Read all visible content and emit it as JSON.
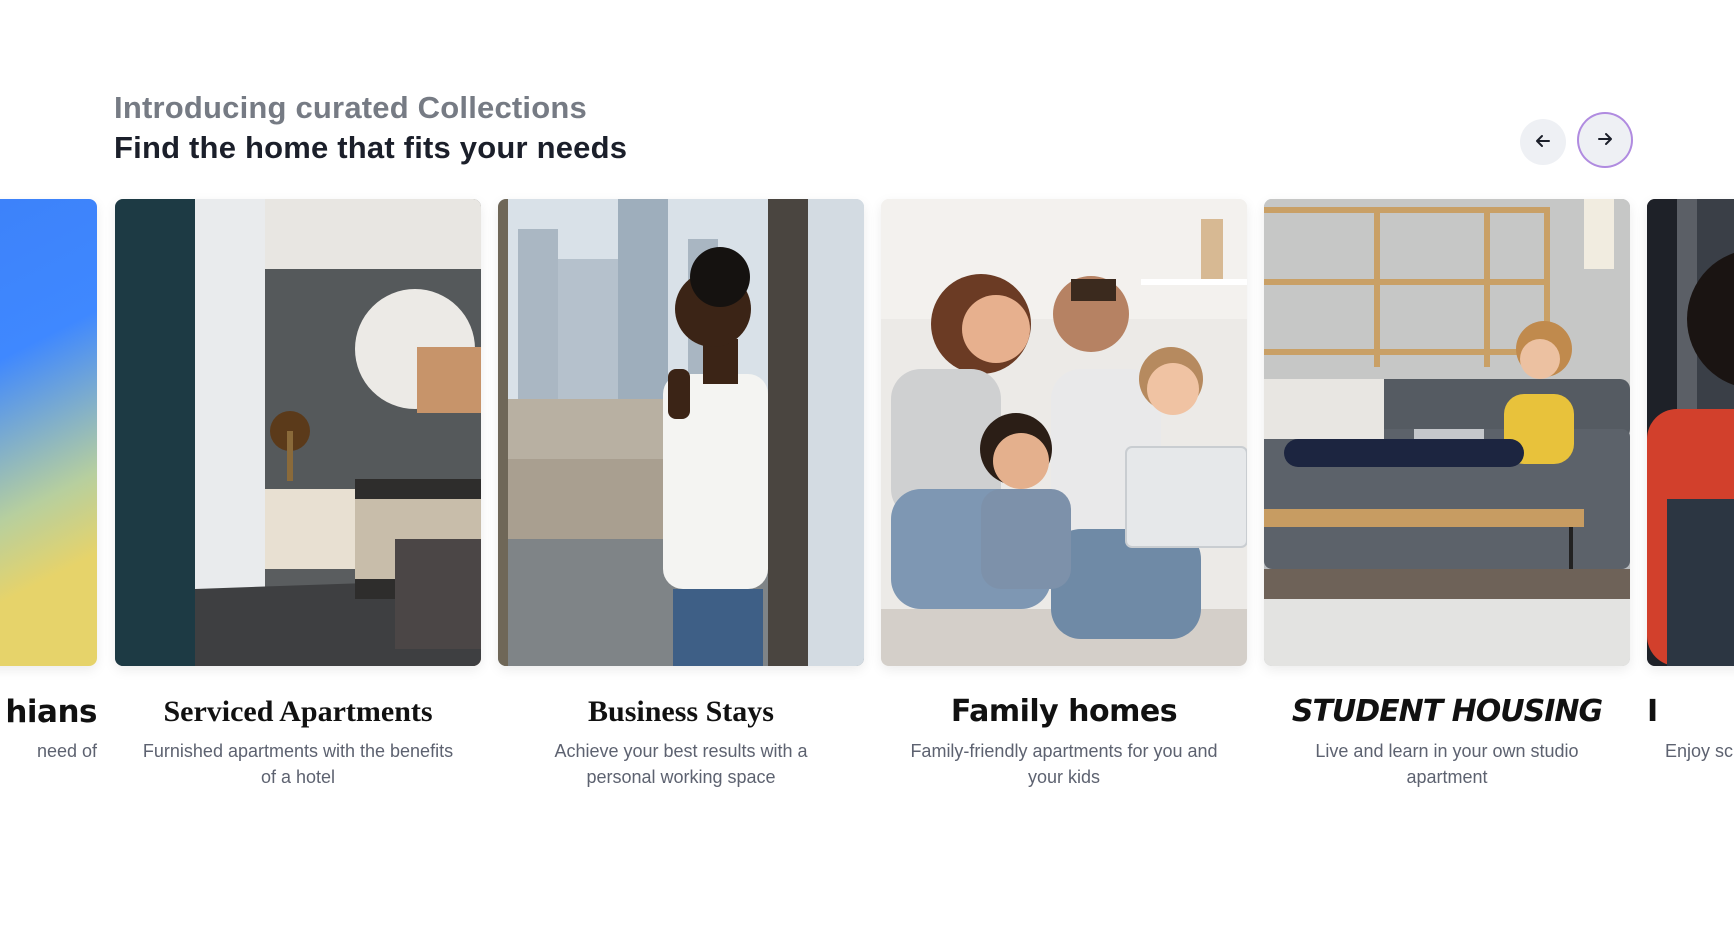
{
  "header": {
    "eyebrow": "Introducing curated Collections",
    "headline": "Find the home that fits your needs"
  },
  "nav": {
    "prev_icon": "arrow-left-icon",
    "next_icon": "arrow-right-icon"
  },
  "cards": [
    {
      "title": "hians",
      "description": "need of",
      "style": "marker",
      "image": "blue-yellow-gradient"
    },
    {
      "title": "Serviced Apartments",
      "description": "Furnished apartments with the benefits of a hotel",
      "style": "serif",
      "image": "bedroom-photo"
    },
    {
      "title": "Business Stays",
      "description": "Achieve your best results with a personal working space",
      "style": "serif",
      "image": "businessman-phone-photo"
    },
    {
      "title": "Family homes",
      "description": "Family-friendly apartments for you and your kids",
      "style": "marker",
      "image": "family-laptop-photo"
    },
    {
      "title": "STUDENT HOUSING",
      "description": "Live and learn in your own studio apartment",
      "style": "caps",
      "image": "student-sofa-photo"
    },
    {
      "title": "I",
      "description": "Enjoy sc",
      "style": "marker",
      "image": "person-red-photo"
    }
  ],
  "colors": {
    "accent_ring": "#b08be0",
    "eyebrow": "#767b84",
    "headline": "#1b1f2a",
    "nav_bg": "#eef0f4"
  }
}
